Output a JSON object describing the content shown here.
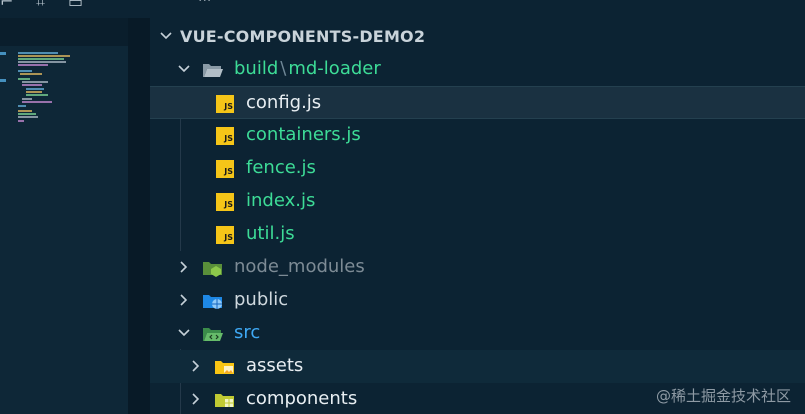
{
  "colors": {
    "background": "#0c2333",
    "selected_row": "#1a3141",
    "hover_row": "#0f2a3a",
    "folder_text": "#3ddc97",
    "js_text": "#3ddc97",
    "selected_text": "#e8eef2",
    "dim_text": "#7d8b95",
    "public_text": "#cfd8de",
    "src_text": "#3fa9f5",
    "assets_text": "#e8eef2",
    "components_text": "#e8eef2",
    "js_badge": "#f5c518"
  },
  "topbar": {
    "label": "···"
  },
  "explorer": {
    "root_title": "VUE-COMPONENTS-DEMO2",
    "items": [
      {
        "type": "folder-open",
        "label_a": "build",
        "separator": "\\",
        "label_b": "md-loader",
        "icon": "folder-open-icon",
        "expanded": true
      },
      {
        "type": "file",
        "label": "config.js",
        "icon": "js-file-icon",
        "selected": true
      },
      {
        "type": "file",
        "label": "containers.js",
        "icon": "js-file-icon"
      },
      {
        "type": "file",
        "label": "fence.js",
        "icon": "js-file-icon"
      },
      {
        "type": "file",
        "label": "index.js",
        "icon": "js-file-icon"
      },
      {
        "type": "file",
        "label": "util.js",
        "icon": "js-file-icon"
      },
      {
        "type": "folder",
        "label": "node_modules",
        "icon": "node-folder-icon",
        "expanded": false
      },
      {
        "type": "folder",
        "label": "public",
        "icon": "public-folder-icon",
        "expanded": false
      },
      {
        "type": "folder-open",
        "label": "src",
        "icon": "src-folder-icon",
        "expanded": true
      },
      {
        "type": "folder",
        "label": "assets",
        "icon": "assets-folder-icon",
        "expanded": false
      },
      {
        "type": "folder",
        "label": "components",
        "icon": "components-folder-icon",
        "expanded": false
      }
    ],
    "js_badge_text": "JS"
  },
  "watermark": "@稀土掘金技术社区"
}
